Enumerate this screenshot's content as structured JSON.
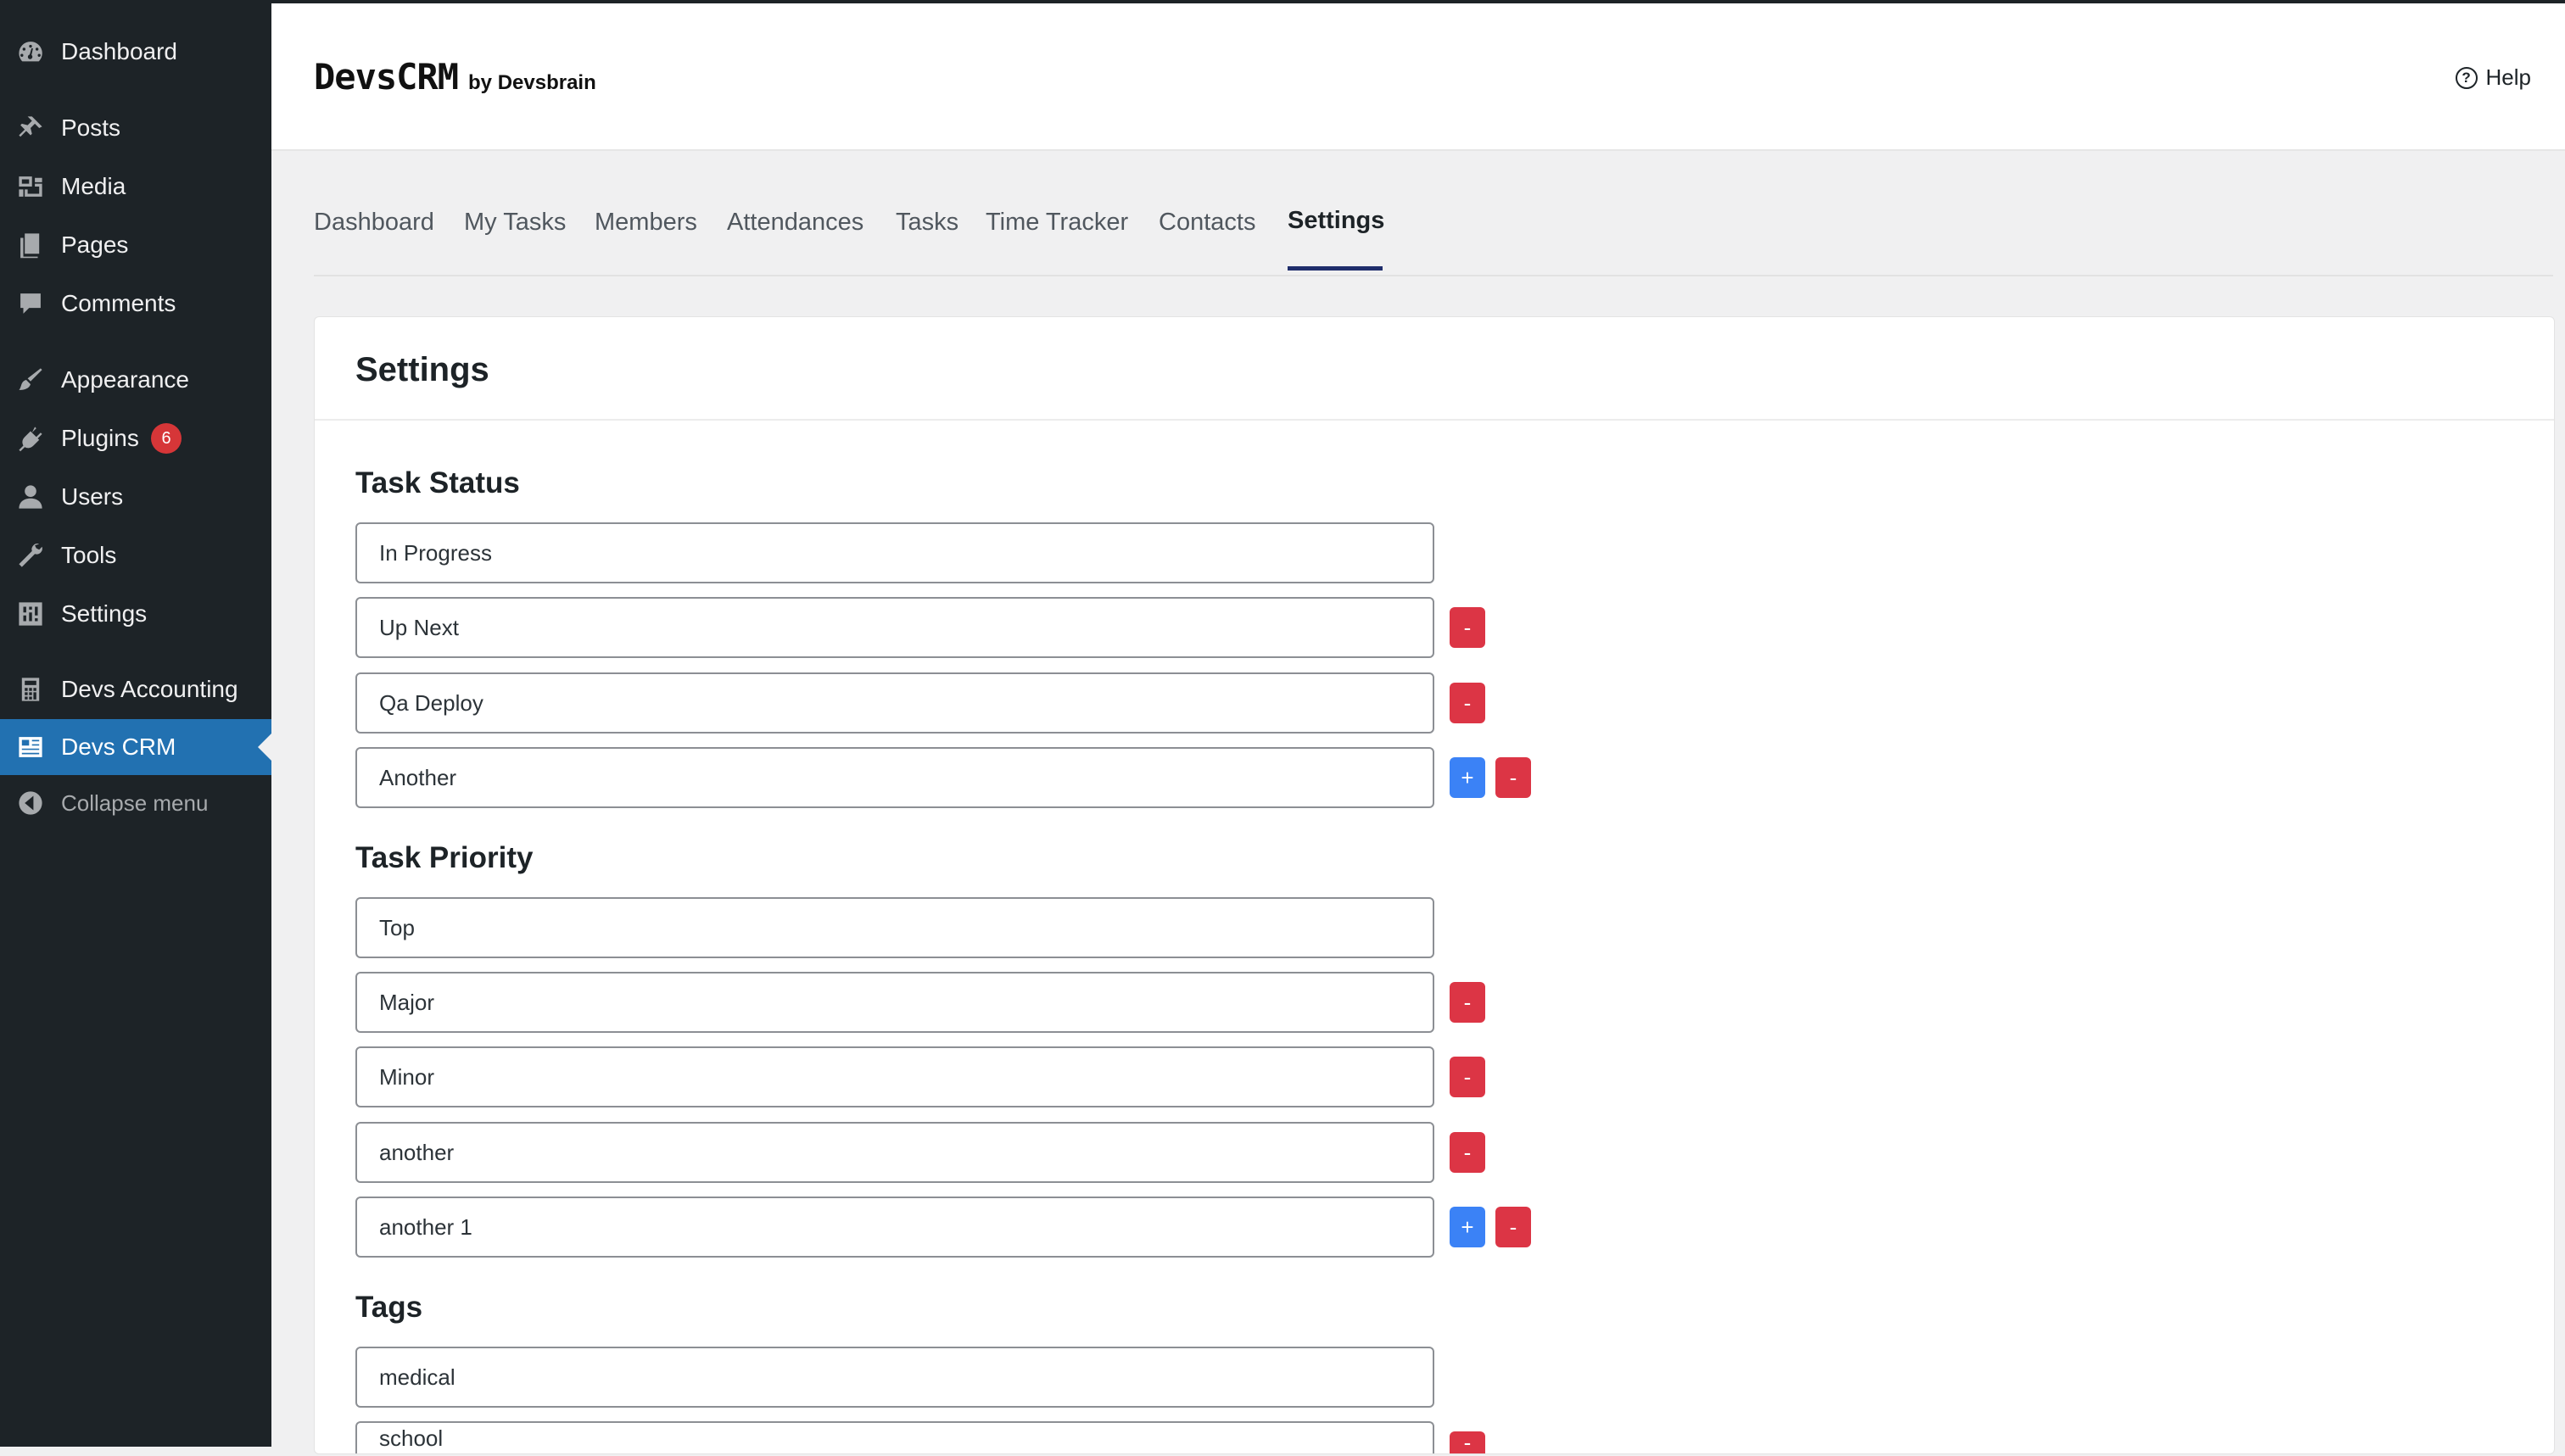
{
  "sidebar": {
    "items": [
      {
        "label": "Dashboard",
        "icon": "dashboard-icon"
      },
      {
        "label": "Posts",
        "icon": "pin-icon"
      },
      {
        "label": "Media",
        "icon": "media-icon"
      },
      {
        "label": "Pages",
        "icon": "pages-icon"
      },
      {
        "label": "Comments",
        "icon": "comment-icon"
      },
      {
        "label": "Appearance",
        "icon": "brush-icon"
      },
      {
        "label": "Plugins",
        "icon": "plugin-icon",
        "badge": "6"
      },
      {
        "label": "Users",
        "icon": "user-icon"
      },
      {
        "label": "Tools",
        "icon": "wrench-icon"
      },
      {
        "label": "Settings",
        "icon": "settings-sliders-icon"
      },
      {
        "label": "Devs Accounting",
        "icon": "calculator-icon"
      },
      {
        "label": "Devs CRM",
        "icon": "id-card-icon",
        "active": true
      },
      {
        "label": "Collapse menu",
        "icon": "collapse-arrow-icon"
      }
    ]
  },
  "header": {
    "brand_name": "DevsCRM",
    "brand_by": "by Devsbrain",
    "help_label": "Help",
    "help_icon_glyph": "?"
  },
  "tabs": [
    {
      "label": "Dashboard"
    },
    {
      "label": "My Tasks"
    },
    {
      "label": "Members"
    },
    {
      "label": "Attendances"
    },
    {
      "label": "Tasks"
    },
    {
      "label": "Time Tracker"
    },
    {
      "label": "Contacts"
    },
    {
      "label": "Settings",
      "active": true
    }
  ],
  "settings": {
    "title": "Settings",
    "sections": [
      {
        "title": "Task Status",
        "values": [
          "In Progress",
          "Up Next",
          "Qa Deploy",
          "Another"
        ]
      },
      {
        "title": "Task Priority",
        "values": [
          "Top",
          "Major",
          "Minor",
          "another",
          "another 1"
        ]
      },
      {
        "title": "Tags",
        "values": [
          "medical",
          "school"
        ]
      }
    ],
    "remove_label": "-",
    "add_label": "+"
  },
  "colors": {
    "sidebar_bg": "#1d2327",
    "active_menu": "#2271b1",
    "remove_button": "#dc3545",
    "add_button": "#3b82f6",
    "tab_underline": "#1f2d6b",
    "plugin_badge": "#d63638"
  }
}
